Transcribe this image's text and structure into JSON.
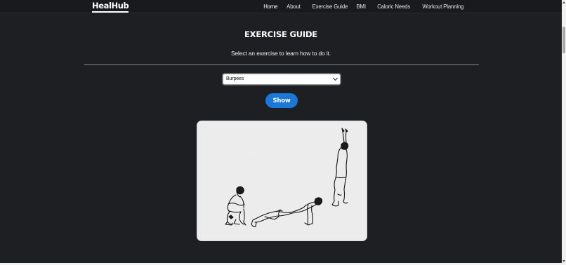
{
  "navbar": {
    "brand": "HealHub",
    "links": [
      "Home",
      "About",
      "Exercise Guide",
      "BMI",
      "Caloric Needs",
      "Workout Planning"
    ]
  },
  "main": {
    "title": "EXERCISE GUIDE",
    "subtitle": "Select an exercise to learn how to do it.",
    "exercise_select": {
      "value": "Burpees"
    },
    "show_button_label": "Show",
    "illustration": "burpees-exercise-illustration"
  },
  "colors": {
    "background": "#1e1f22",
    "navbar": "#191a1d",
    "button": "#1a78d8",
    "card": "#ececec"
  }
}
